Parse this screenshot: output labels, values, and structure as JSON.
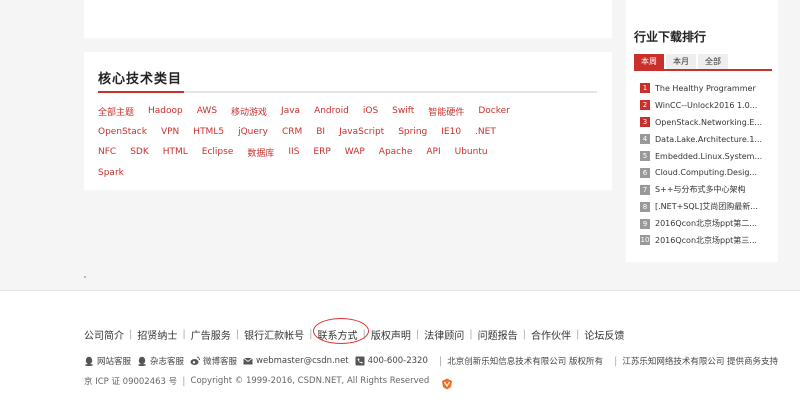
{
  "tech": {
    "title": "核心技术类目",
    "rows": [
      [
        "全部主题",
        "Hadoop",
        "AWS",
        "移动游戏",
        "Java",
        "Android",
        "iOS",
        "Swift",
        "智能硬件",
        "Docker"
      ],
      [
        "OpenStack",
        "VPN",
        "HTML5",
        "jQuery",
        "CRM",
        "BI",
        "JavaScript",
        "Spring",
        "IE10",
        ".NET"
      ],
      [
        "NFC",
        "SDK",
        "HTML",
        "Eclipse",
        "数据库",
        "IIS",
        "ERP",
        "WAP",
        "Apache",
        "API",
        "Ubuntu"
      ],
      [
        "Spark"
      ]
    ]
  },
  "rank": {
    "title": "行业下载排行",
    "tabs": [
      "本周",
      "本月",
      "全部"
    ],
    "items": [
      {
        "num": "1",
        "text": "The Healthy Programmer"
      },
      {
        "num": "2",
        "text": "WinCC--Unlock2016 1.0..."
      },
      {
        "num": "3",
        "text": "OpenStack.Networking.E..."
      },
      {
        "num": "4",
        "text": "Data.Lake.Architecture.1..."
      },
      {
        "num": "5",
        "text": "Embedded.Linux.System..."
      },
      {
        "num": "6",
        "text": "Cloud.Computing.Desig..."
      },
      {
        "num": "7",
        "text": "S++与分布式多中心架构"
      },
      {
        "num": "8",
        "text": "[.NET+SQL]艾尚团购最新..."
      },
      {
        "num": "9",
        "text": "2016Qcon北京场ppt第二..."
      },
      {
        "num": "10",
        "text": "2016Qcon北京场ppt第三..."
      }
    ]
  },
  "footer": {
    "links": [
      "公司简介",
      "招贤纳士",
      "广告服务",
      "银行汇款帐号",
      "联系方式",
      "版权声明",
      "法律顾问",
      "问题报告",
      "合作伙伴",
      "论坛反馈"
    ],
    "contacts": {
      "site_service": "网站客服",
      "magazine_service": "杂志客服",
      "weibo_service": "微博客服",
      "email": "webmaster@csdn.net",
      "phone": "400-600-2320",
      "company_1": "北京创新乐知信息技术有限公司 版权所有",
      "company_2": "江苏乐知网络技术有限公司 提供商务支持"
    },
    "icp": "京 ICP 证 09002463 号",
    "copyright": "Copyright © 1999-2016, CSDN.NET, All Rights Reserved"
  },
  "colors": {
    "accent": "#c9302c"
  }
}
